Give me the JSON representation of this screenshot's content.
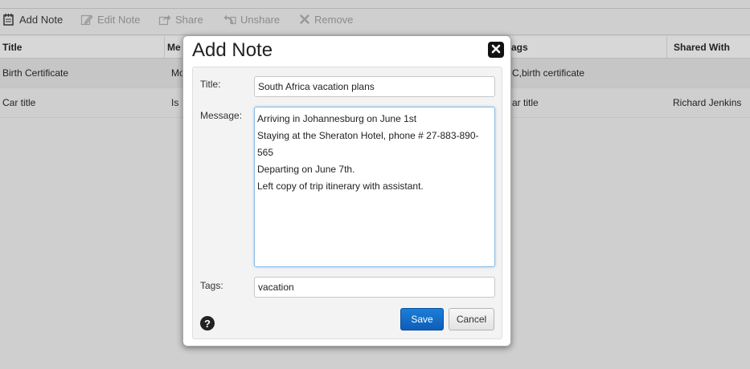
{
  "toolbar": {
    "add_note": "Add Note",
    "edit_note": "Edit Note",
    "share": "Share",
    "unshare": "Unshare",
    "remove": "Remove"
  },
  "grid": {
    "columns": [
      "Title",
      "Me",
      "ags",
      "Shared With"
    ],
    "rows": [
      {
        "title": "Birth Certificate",
        "message": "Mo",
        "tags": "C,birth certificate",
        "shared_with": ""
      },
      {
        "title": "Car title",
        "message": "Is",
        "tags": "ar title",
        "shared_with": "Richard Jenkins"
      }
    ]
  },
  "dialog": {
    "title": "Add Note",
    "title_label": "Title:",
    "title_value": "South Africa vacation plans",
    "message_label": "Message:",
    "message_value": "Arriving in Johannesburg on June 1st\nStaying at the Sheraton Hotel, phone # 27-883-890-565\nDeparting on June 7th.\nLeft copy of trip itinerary with assistant.",
    "tags_label": "Tags:",
    "tags_value": "vacation",
    "save_label": "Save",
    "cancel_label": "Cancel",
    "help_glyph": "?"
  },
  "icons": {
    "add_note": "notepad-icon",
    "edit_note": "pencil-icon",
    "share": "share-arrow-icon",
    "unshare": "unshare-icon",
    "remove": "x-icon",
    "close": "close-icon",
    "help": "question-icon"
  }
}
